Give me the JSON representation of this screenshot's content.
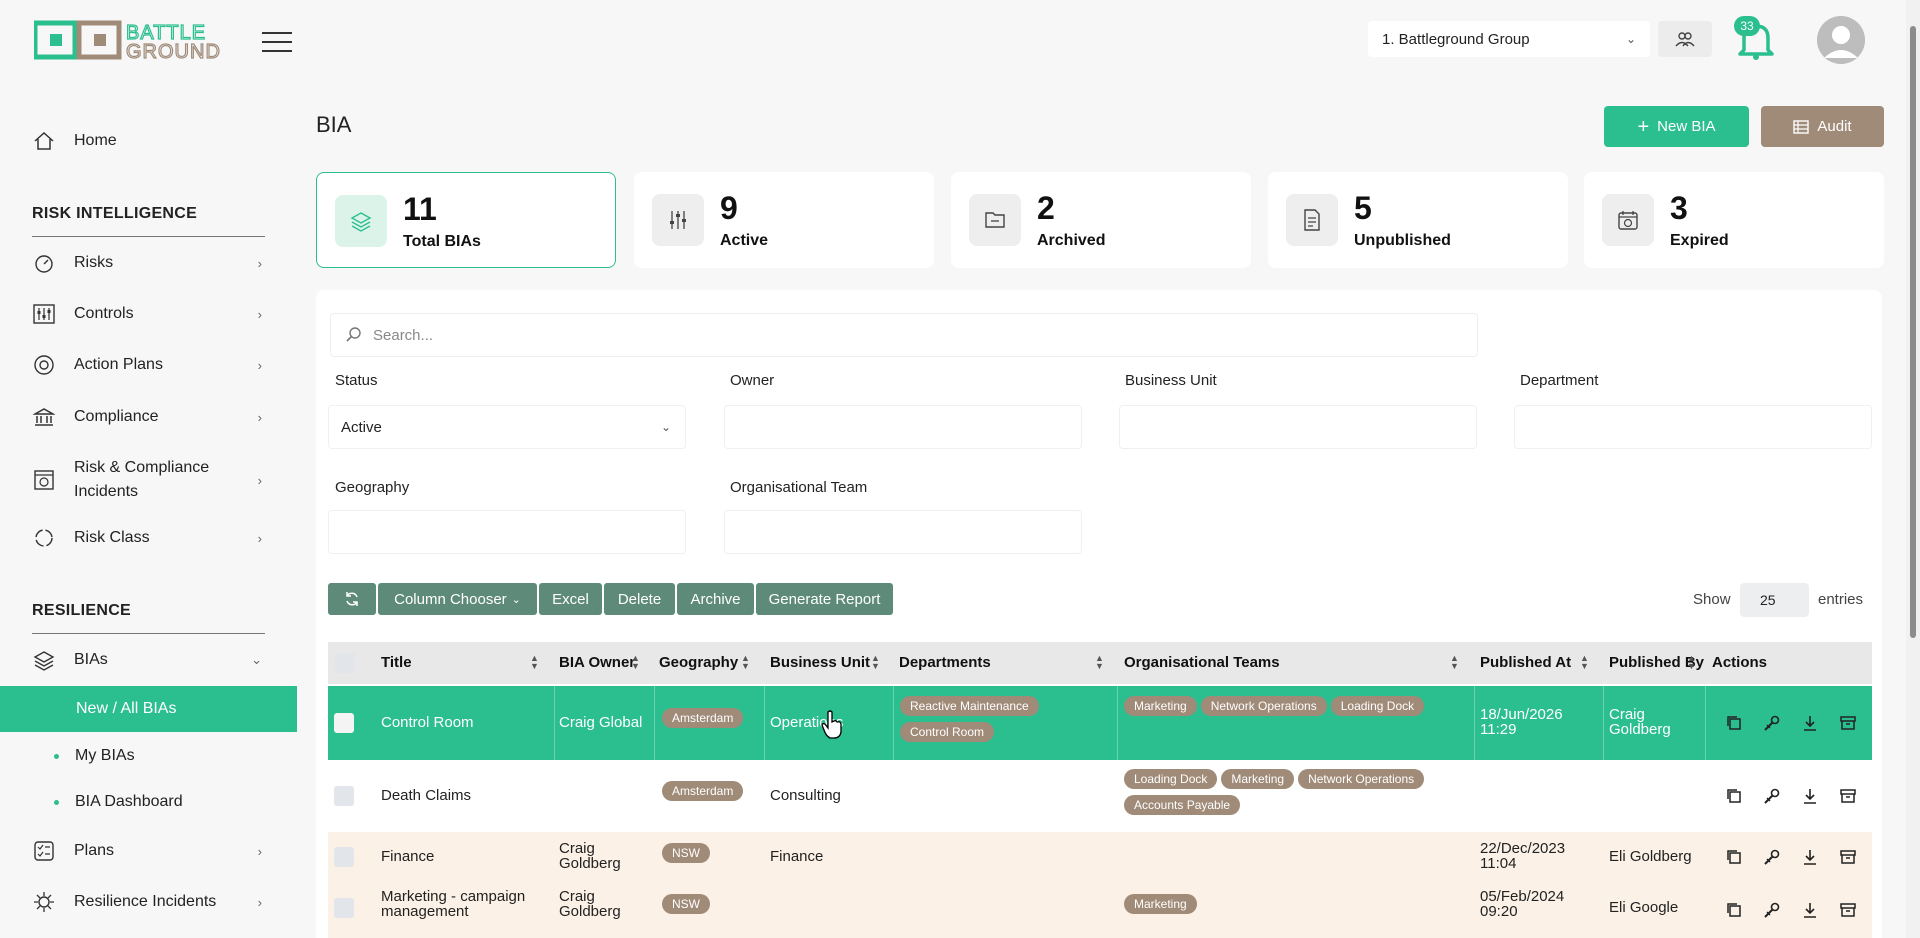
{
  "header": {
    "org_select": "1. Battleground Group",
    "notification_count": "33"
  },
  "sidebar": {
    "home": "Home",
    "section_risk": "RISK INTELLIGENCE",
    "risk_items": [
      "Risks",
      "Controls",
      "Action Plans",
      "Compliance",
      "Risk & Compliance Incidents",
      "Risk Class"
    ],
    "section_resilience": "RESILIENCE",
    "bias": "BIAs",
    "sub_items": [
      "New / All BIAs",
      "My BIAs",
      "BIA Dashboard"
    ],
    "plans": "Plans",
    "resilience_incidents": "Resilience Incidents"
  },
  "page": {
    "title": "BIA",
    "new_bia": "New BIA",
    "audit": "Audit"
  },
  "stats": [
    {
      "value": "11",
      "label": "Total BIAs"
    },
    {
      "value": "9",
      "label": "Active"
    },
    {
      "value": "2",
      "label": "Archived"
    },
    {
      "value": "5",
      "label": "Unpublished"
    },
    {
      "value": "3",
      "label": "Expired"
    }
  ],
  "filters": {
    "search_placeholder": "Search...",
    "status_label": "Status",
    "status_value": "Active",
    "owner_label": "Owner",
    "business_unit_label": "Business Unit",
    "department_label": "Department",
    "geography_label": "Geography",
    "org_team_label": "Organisational Team"
  },
  "toolbar": {
    "column_chooser": "Column Chooser",
    "excel": "Excel",
    "delete": "Delete",
    "archive": "Archive",
    "generate_report": "Generate Report",
    "show": "Show",
    "entries_value": "25",
    "entries": "entries"
  },
  "table": {
    "columns": [
      "Title",
      "BIA Owner",
      "Geography",
      "Business Unit",
      "Departments",
      "Organisational Teams",
      "Published At",
      "Published By",
      "Actions"
    ],
    "rows": [
      {
        "title": "Control Room",
        "owner": "Craig Global",
        "geography": "Amsterdam",
        "business_unit": "Operations",
        "departments": [
          "Reactive Maintenance",
          "Control Room"
        ],
        "teams": [
          "Marketing",
          "Network Operations",
          "Loading Dock"
        ],
        "published_at": "18/Jun/2026 11:29",
        "published_by": "Craig Goldberg"
      },
      {
        "title": "Death Claims",
        "owner": "",
        "geography": "Amsterdam",
        "business_unit": "Consulting",
        "departments": [],
        "teams": [
          "Loading Dock",
          "Marketing",
          "Network Operations",
          "Accounts Payable"
        ],
        "published_at": "",
        "published_by": ""
      },
      {
        "title": "Finance",
        "owner": "Craig Goldberg",
        "geography": "NSW",
        "business_unit": "Finance",
        "departments": [],
        "teams": [],
        "published_at": "22/Dec/2023 11:04",
        "published_by": "Eli Goldberg"
      },
      {
        "title": "Marketing - campaign management",
        "owner": "Craig Goldberg",
        "geography": "NSW",
        "business_unit": "",
        "departments": [],
        "teams": [
          "Marketing"
        ],
        "published_at": "05/Feb/2024 09:20",
        "published_by": "Eli Google"
      }
    ]
  },
  "colors": {
    "accent": "#2bbf8f",
    "brown": "#a08a78",
    "toolbar": "#5e8a7a",
    "row_highlight": "#fbf1e6"
  }
}
